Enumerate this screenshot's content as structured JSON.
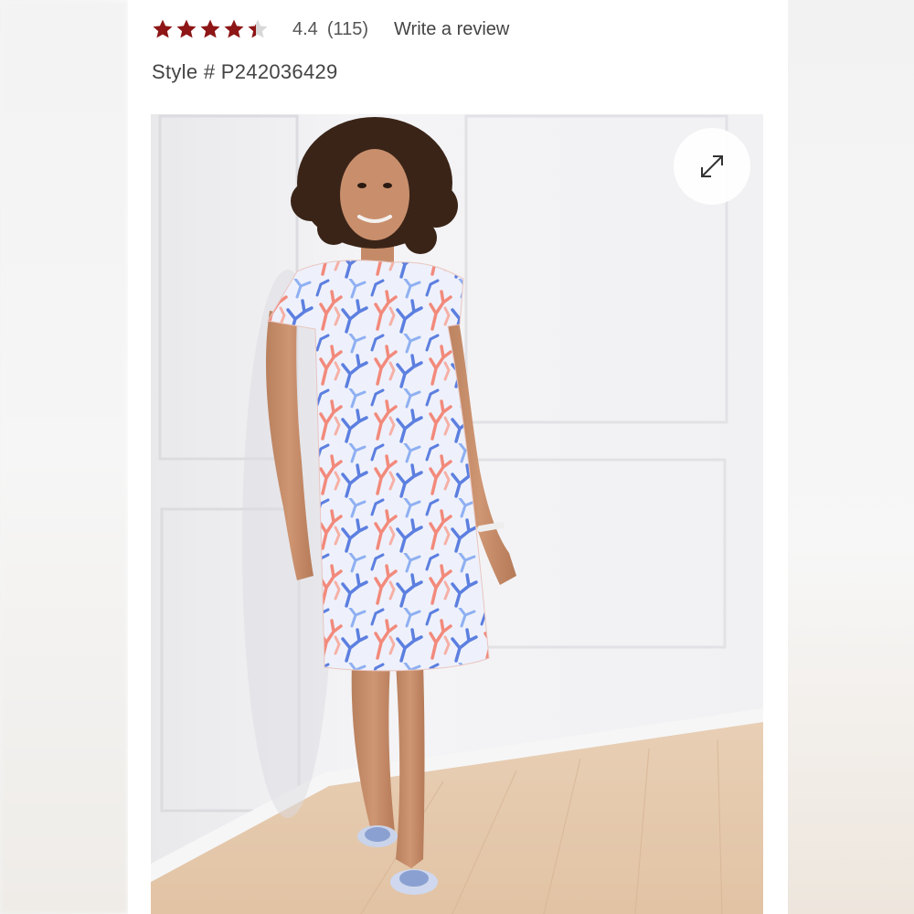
{
  "rating": {
    "stars_filled": 4.4,
    "stars_total": 5,
    "value": "4.4",
    "count": "(115)",
    "star_color": "#8e1616",
    "empty_star_color": "#d8d8d8"
  },
  "review_link": {
    "label": "Write a review"
  },
  "product": {
    "style_label": "Style # P242036429"
  },
  "gallery": {
    "expand_icon": "expand-arrows-icon",
    "dress_colors": [
      "#f28a7c",
      "#5c7fe0",
      "#8fb0f2",
      "#ffffff"
    ]
  }
}
